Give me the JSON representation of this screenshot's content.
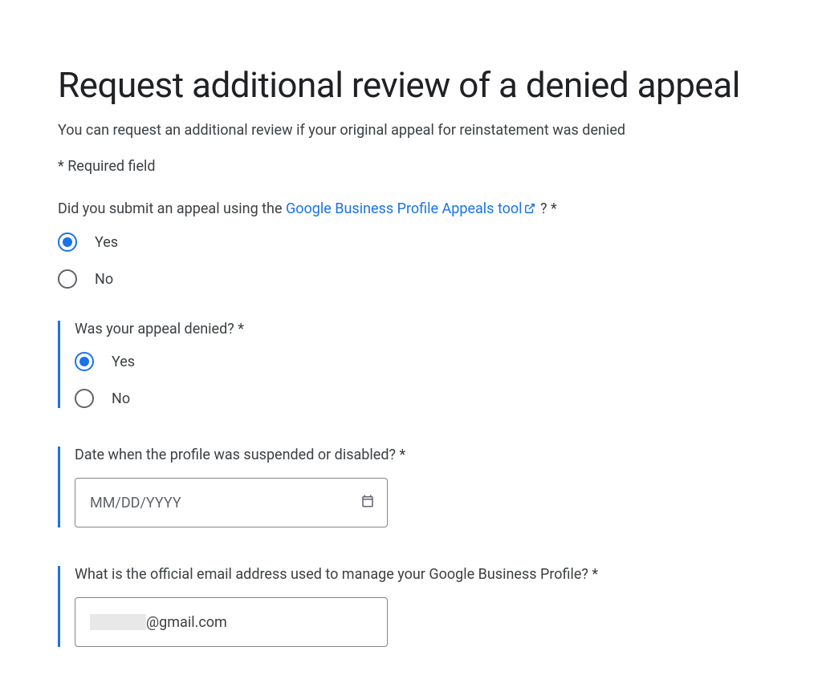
{
  "title": "Request additional review of a denied appeal",
  "intro": "You can request an additional review if your original appeal for reinstatement was denied",
  "required_note": "* Required field",
  "q1": {
    "prefix": "Did you submit an appeal using the ",
    "link_text": "Google Business Profile Appeals tool",
    "suffix": " ? *",
    "options": {
      "yes": "Yes",
      "no": "No"
    }
  },
  "q2": {
    "label": "Was your appeal denied? *",
    "options": {
      "yes": "Yes",
      "no": "No"
    }
  },
  "q3": {
    "label": "Date when the profile was suspended or disabled? *",
    "placeholder": "MM/DD/YYYY"
  },
  "q4": {
    "label": "What is the official email address used to manage your Google Business Profile? *",
    "value_suffix": "@gmail.com"
  }
}
